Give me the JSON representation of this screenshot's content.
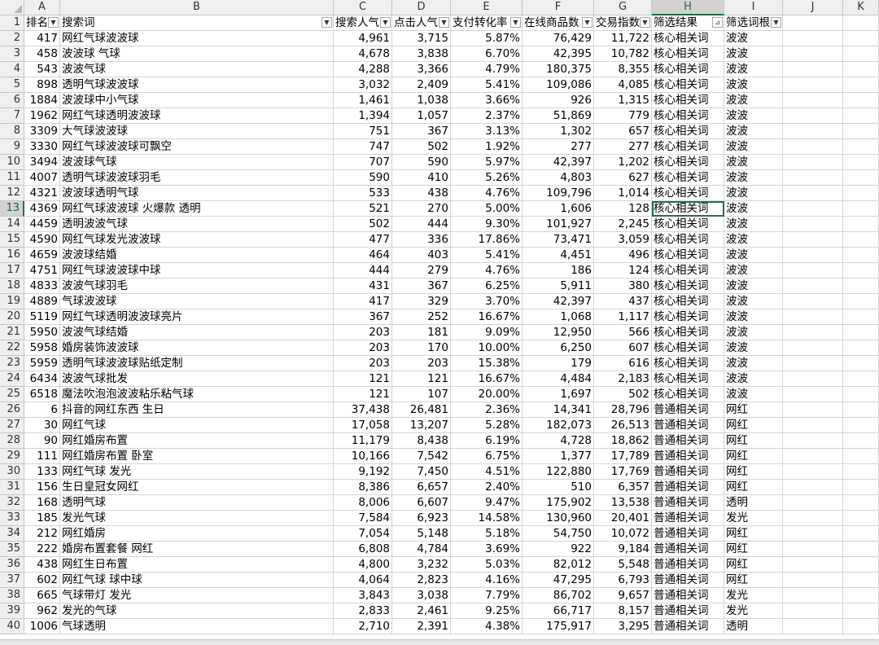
{
  "columns": [
    "A",
    "B",
    "C",
    "D",
    "E",
    "F",
    "G",
    "H",
    "I",
    "J",
    "K"
  ],
  "headers": [
    "排名",
    "搜索词",
    "搜索人气",
    "点击人气",
    "支付转化率",
    "在线商品数",
    "交易指数",
    "筛选结果",
    "筛选词根"
  ],
  "header_display": [
    "排名",
    "搜索词",
    "搜索人气",
    "点击人气",
    "支付转化率",
    "在线商品数",
    "交易指数",
    "筛选结果",
    "筛选词根"
  ],
  "active_cell": "H13",
  "rows": [
    [
      "417",
      "网红气球波波球",
      "4,961",
      "3,715",
      "5.87%",
      "76,429",
      "11,722",
      "核心相关词",
      "波波"
    ],
    [
      "458",
      "波波球 气球",
      "4,678",
      "3,838",
      "6.70%",
      "42,395",
      "10,782",
      "核心相关词",
      "波波"
    ],
    [
      "543",
      "波波气球",
      "4,288",
      "3,366",
      "4.79%",
      "180,375",
      "8,355",
      "核心相关词",
      "波波"
    ],
    [
      "898",
      "透明气球波波球",
      "3,032",
      "2,409",
      "5.41%",
      "109,086",
      "4,085",
      "核心相关词",
      "波波"
    ],
    [
      "1884",
      "波波球中小气球",
      "1,461",
      "1,038",
      "3.66%",
      "926",
      "1,315",
      "核心相关词",
      "波波"
    ],
    [
      "1962",
      "网红气球透明波波球",
      "1,394",
      "1,057",
      "2.37%",
      "51,869",
      "779",
      "核心相关词",
      "波波"
    ],
    [
      "3309",
      "大气球波波球",
      "751",
      "367",
      "3.13%",
      "1,302",
      "657",
      "核心相关词",
      "波波"
    ],
    [
      "3330",
      "网红气球波波球可飘空",
      "747",
      "502",
      "1.92%",
      "277",
      "277",
      "核心相关词",
      "波波"
    ],
    [
      "3494",
      "波波球气球",
      "707",
      "590",
      "5.97%",
      "42,397",
      "1,202",
      "核心相关词",
      "波波"
    ],
    [
      "4007",
      "透明气球波波球羽毛",
      "590",
      "410",
      "5.26%",
      "4,803",
      "627",
      "核心相关词",
      "波波"
    ],
    [
      "4321",
      "波波球透明气球",
      "533",
      "438",
      "4.76%",
      "109,796",
      "1,014",
      "核心相关词",
      "波波"
    ],
    [
      "4369",
      "网红气球波波球 火爆款 透明",
      "521",
      "270",
      "5.00%",
      "1,606",
      "128",
      "核心相关词",
      "波波"
    ],
    [
      "4459",
      "透明波波气球",
      "502",
      "444",
      "9.30%",
      "101,927",
      "2,245",
      "核心相关词",
      "波波"
    ],
    [
      "4590",
      "网红气球发光波波球",
      "477",
      "336",
      "17.86%",
      "73,471",
      "3,059",
      "核心相关词",
      "波波"
    ],
    [
      "4659",
      "波波球结婚",
      "464",
      "403",
      "5.41%",
      "4,451",
      "496",
      "核心相关词",
      "波波"
    ],
    [
      "4751",
      "网红气球波波球中球",
      "444",
      "279",
      "4.76%",
      "186",
      "124",
      "核心相关词",
      "波波"
    ],
    [
      "4833",
      "波波气球羽毛",
      "431",
      "367",
      "6.25%",
      "5,911",
      "380",
      "核心相关词",
      "波波"
    ],
    [
      "4889",
      "气球波波球",
      "417",
      "329",
      "3.70%",
      "42,397",
      "437",
      "核心相关词",
      "波波"
    ],
    [
      "5119",
      "网红气球透明波波球亮片",
      "367",
      "252",
      "16.67%",
      "1,068",
      "1,117",
      "核心相关词",
      "波波"
    ],
    [
      "5950",
      "波波气球结婚",
      "203",
      "181",
      "9.09%",
      "12,950",
      "566",
      "核心相关词",
      "波波"
    ],
    [
      "5958",
      "婚房装饰波波球",
      "203",
      "170",
      "10.00%",
      "6,250",
      "607",
      "核心相关词",
      "波波"
    ],
    [
      "5959",
      "透明气球波波球贴纸定制",
      "203",
      "203",
      "15.38%",
      "179",
      "616",
      "核心相关词",
      "波波"
    ],
    [
      "6434",
      "波波气球批发",
      "121",
      "121",
      "16.67%",
      "4,484",
      "2,183",
      "核心相关词",
      "波波"
    ],
    [
      "6518",
      "魔法吹泡泡波波粘乐粘气球",
      "121",
      "107",
      "20.00%",
      "1,697",
      "502",
      "核心相关词",
      "波波"
    ],
    [
      "6",
      "抖音的网红东西 生日",
      "37,438",
      "26,481",
      "2.36%",
      "14,341",
      "28,796",
      "普通相关词",
      "网红"
    ],
    [
      "30",
      "网红气球",
      "17,058",
      "13,207",
      "5.28%",
      "182,073",
      "26,513",
      "普通相关词",
      "网红"
    ],
    [
      "90",
      "网红婚房布置",
      "11,179",
      "8,438",
      "6.19%",
      "4,728",
      "18,862",
      "普通相关词",
      "网红"
    ],
    [
      "111",
      "网红婚房布置 卧室",
      "10,166",
      "7,542",
      "6.75%",
      "1,377",
      "17,789",
      "普通相关词",
      "网红"
    ],
    [
      "133",
      "网红气球 发光",
      "9,192",
      "7,450",
      "4.51%",
      "122,880",
      "17,769",
      "普通相关词",
      "网红"
    ],
    [
      "156",
      "生日皇冠女网红",
      "8,386",
      "6,657",
      "2.40%",
      "510",
      "6,357",
      "普通相关词",
      "网红"
    ],
    [
      "168",
      "透明气球",
      "8,006",
      "6,607",
      "9.47%",
      "175,902",
      "13,538",
      "普通相关词",
      "透明"
    ],
    [
      "185",
      "发光气球",
      "7,584",
      "6,923",
      "14.58%",
      "130,960",
      "20,401",
      "普通相关词",
      "发光"
    ],
    [
      "212",
      "网红婚房",
      "7,054",
      "5,148",
      "5.18%",
      "54,750",
      "10,072",
      "普通相关词",
      "网红"
    ],
    [
      "222",
      "婚房布置套餐 网红",
      "6,808",
      "4,784",
      "3.69%",
      "922",
      "9,184",
      "普通相关词",
      "网红"
    ],
    [
      "438",
      "网红生日布置",
      "4,800",
      "3,232",
      "5.03%",
      "82,012",
      "5,548",
      "普通相关词",
      "网红"
    ],
    [
      "602",
      "网红气球 球中球",
      "4,064",
      "2,823",
      "4.16%",
      "47,295",
      "6,793",
      "普通相关词",
      "网红"
    ],
    [
      "665",
      "气球带灯 发光",
      "3,843",
      "3,038",
      "7.79%",
      "86,702",
      "9,657",
      "普通相关词",
      "发光"
    ],
    [
      "962",
      "发光的气球",
      "2,833",
      "2,461",
      "9.25%",
      "66,717",
      "8,157",
      "普通相关词",
      "发光"
    ],
    [
      "1006",
      "气球透明",
      "2,710",
      "2,391",
      "4.38%",
      "175,917",
      "3,295",
      "普通相关词",
      "透明"
    ]
  ]
}
